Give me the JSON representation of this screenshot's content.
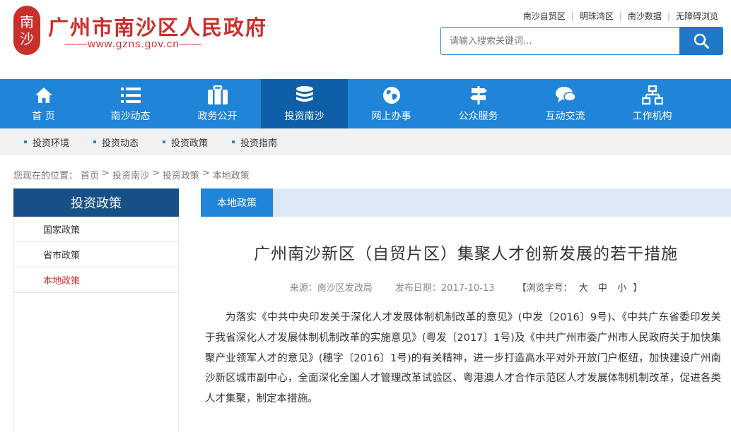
{
  "header": {
    "seal_chars": [
      "南",
      "沙"
    ],
    "site_title": "广州市南沙区人民政府",
    "site_url": "——www.gzns.gov.cn——",
    "top_links": [
      "南沙自贸区",
      "明珠湾区",
      "南沙数据",
      "无障碍浏览"
    ],
    "search_placeholder": "请输入搜索关键词..."
  },
  "nav": {
    "items": [
      {
        "label": "首 页",
        "icon": "home-icon"
      },
      {
        "label": "南沙动态",
        "icon": "list-icon"
      },
      {
        "label": "政务公开",
        "icon": "briefcase-icon"
      },
      {
        "label": "投资南沙",
        "icon": "coins-icon",
        "active": true
      },
      {
        "label": "网上办事",
        "icon": "globe-icon"
      },
      {
        "label": "公众服务",
        "icon": "signpost-icon"
      },
      {
        "label": "互动交流",
        "icon": "chat-icon"
      },
      {
        "label": "工作机构",
        "icon": "org-chart-icon"
      }
    ],
    "active_color": "#0f5fa8",
    "bar_color": "#2084d9"
  },
  "subnav": {
    "items": [
      "投资环境",
      "投资动态",
      "投资政策",
      "投资指南"
    ]
  },
  "breadcrumb": {
    "prefix": "您现在的位置：",
    "items": [
      "首页",
      ">",
      "投资南沙",
      ">",
      "投资政策",
      ">",
      "本地政策"
    ]
  },
  "sidebar": {
    "title": "投资政策",
    "items": [
      {
        "label": "国家政策"
      },
      {
        "label": "省市政策"
      },
      {
        "label": "本地政策",
        "active": true
      }
    ]
  },
  "content": {
    "tab": "本地政策",
    "title": "广州南沙新区（自贸片区）集聚人才创新发展的若干措施",
    "meta": {
      "source": "来源：南沙区发改局",
      "date": "发布日期：2017-10-13",
      "fontsize_open": "【浏览字号：",
      "size_large": "大",
      "size_medium": "中",
      "size_small": "小",
      "fontsize_close": "】"
    },
    "paragraph": "为落实《中共中央印发关于深化人才发展体制机制改革的意见》(中发〔2016〕9号)、《中共广东省委印发关于我省深化人才发展体制机制改革的实施意见》(粤发〔2017〕1号)及《中共广州市委广州市人民政府关于加快集聚产业领军人才的意见》(穗字〔2016〕1号)的有关精神，进一步打造高水平对外开放门户枢纽，加快建设广州南沙新区城市副中心，全面深化全国人才管理改革试验区、粤港澳人才合作示范区人才发展体制机制改革，促进各类人才集聚，制定本措施。"
  }
}
